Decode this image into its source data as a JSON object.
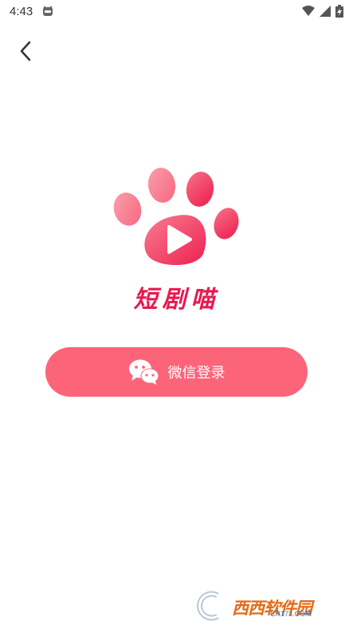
{
  "status_bar": {
    "time": "4:43",
    "app_icon": "cat-face-icon",
    "icons": [
      "wifi-icon",
      "signal-icon",
      "battery-charging-icon"
    ]
  },
  "nav": {
    "back_icon": "chevron-left-icon"
  },
  "app": {
    "logo_icon": "paw-play-icon",
    "name": "短剧喵",
    "brand_color": "#e8194f"
  },
  "login": {
    "label": "微信登录",
    "icon": "wechat-icon",
    "button_color": "#fc6479"
  },
  "watermark": {
    "text": "西西软件园",
    "url": "CR173.COM"
  }
}
